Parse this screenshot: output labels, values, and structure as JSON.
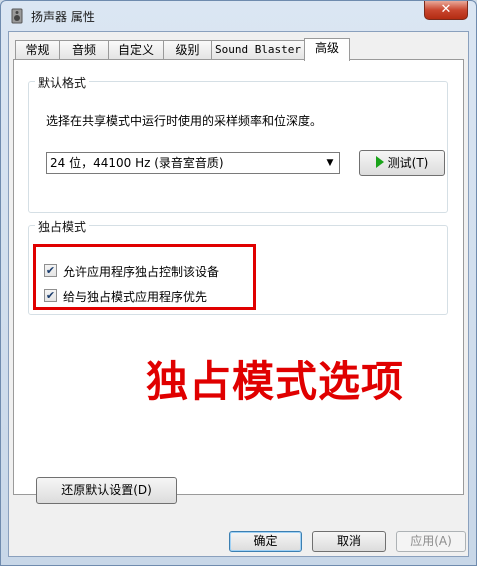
{
  "window": {
    "title": "扬声器 属性",
    "close_glyph": "✕"
  },
  "tabs": [
    {
      "label": "常规"
    },
    {
      "label": "音频"
    },
    {
      "label": "自定义"
    },
    {
      "label": "级别"
    },
    {
      "label": "Sound Blaster"
    },
    {
      "label": "高级"
    }
  ],
  "default_format": {
    "title": "默认格式",
    "description": "选择在共享模式中运行时使用的采样频率和位深度。",
    "selected_value": "24 位，44100 Hz (录音室音质)",
    "test_label": "测试(T)"
  },
  "exclusive_mode": {
    "title": "独占模式",
    "options": [
      {
        "label": "允许应用程序独占控制该设备",
        "checked": true
      },
      {
        "label": "给与独占模式应用程序优先",
        "checked": true
      }
    ]
  },
  "annotation": {
    "text": "独占模式选项",
    "color": "#e00000"
  },
  "buttons": {
    "restore": "还原默认设置(D)",
    "ok": "确定",
    "cancel": "取消",
    "apply": "应用(A)"
  },
  "icons": {
    "app": "speaker-icon",
    "test": "play-icon",
    "dropdown": "chevron-down-icon",
    "check": "checkmark-icon"
  }
}
